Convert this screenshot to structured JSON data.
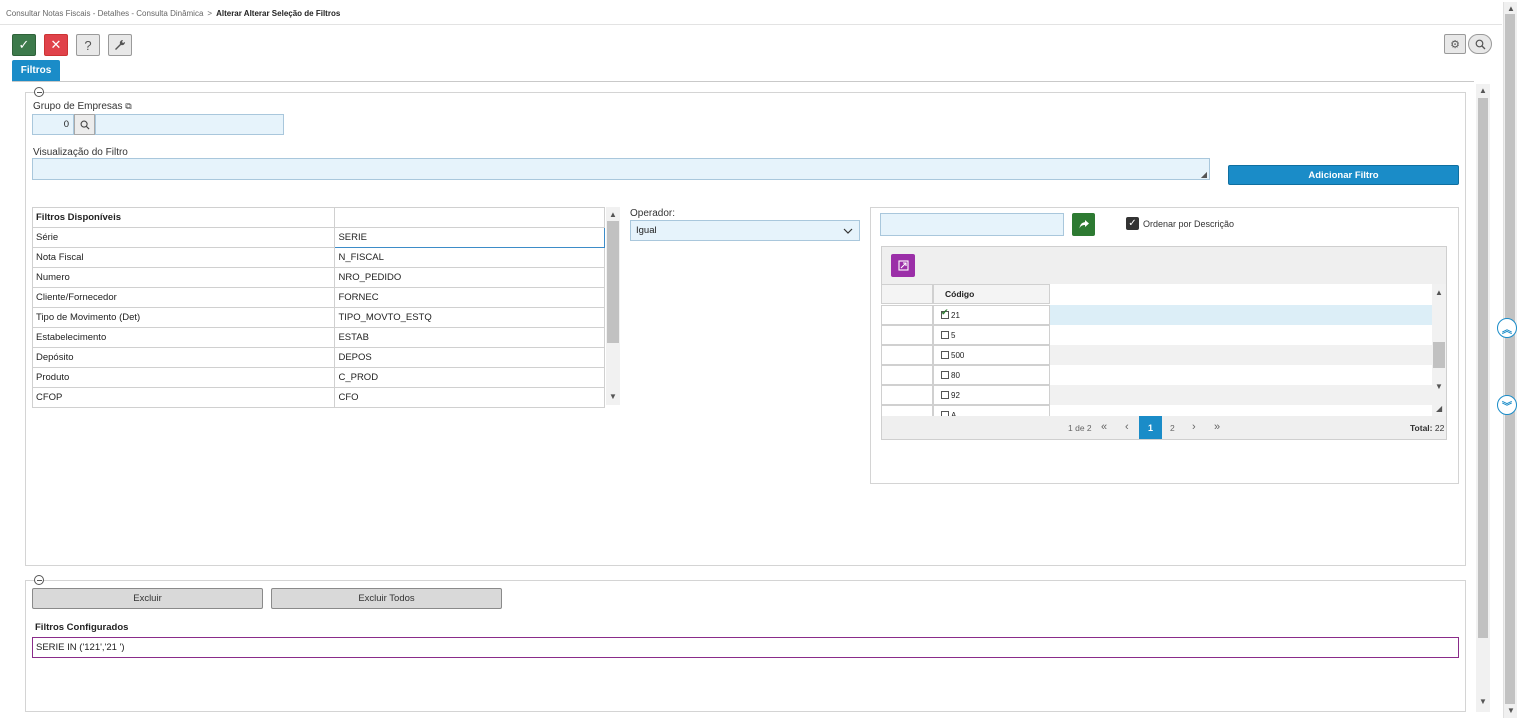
{
  "breadcrumb": {
    "parent": "Consultar Notas Fiscais - Detalhes - Consulta Dinâmica",
    "separator": ">",
    "current": "Alterar Alterar Seleção de Filtros"
  },
  "toolbar": {
    "confirm_icon": "check-icon",
    "cancel_icon": "close-icon",
    "help_label": "?",
    "tools_icon": "wrench-icon"
  },
  "tabs": [
    {
      "label": "Filtros"
    }
  ],
  "form": {
    "grupo_empresas_label": "Grupo de Empresas",
    "grupo_empresas_value": "0",
    "visualizacao_label": "Visualização do Filtro",
    "visualizacao_value": "",
    "add_filter_label": "Adicionar Filtro",
    "operador_label": "Operador:",
    "operador_value": "Igual",
    "search_value": "",
    "ordenar_label": "Ordenar por Descrição"
  },
  "filtros_disponiveis": {
    "header": "Filtros Disponíveis",
    "rows": [
      {
        "label": "Série",
        "field": "SERIE"
      },
      {
        "label": "Nota Fiscal",
        "field": "N_FISCAL"
      },
      {
        "label": "Numero",
        "field": "NRO_PEDIDO"
      },
      {
        "label": "Cliente/Fornecedor",
        "field": "FORNEC"
      },
      {
        "label": "Tipo de Movimento (Det)",
        "field": "TIPO_MOVTO_ESTQ"
      },
      {
        "label": "Estabelecimento",
        "field": "ESTAB"
      },
      {
        "label": "Depósito",
        "field": "DEPOS"
      },
      {
        "label": "Produto",
        "field": "C_PROD"
      },
      {
        "label": "CFOP",
        "field": "CFO"
      }
    ]
  },
  "codigo_grid": {
    "header": "Código",
    "rows": [
      {
        "value": "21",
        "checked": true
      },
      {
        "value": "5",
        "checked": false
      },
      {
        "value": "500",
        "checked": false
      },
      {
        "value": "80",
        "checked": false
      },
      {
        "value": "92",
        "checked": false
      },
      {
        "value": "A",
        "checked": false
      }
    ],
    "pagination": {
      "info": "1 de 2",
      "first": "«",
      "prev": "‹",
      "page1": "1",
      "page2": "2",
      "next": "›",
      "last": "»",
      "total_label": "Total:",
      "total_value": "22"
    }
  },
  "bottom": {
    "excluir_label": "Excluir",
    "excluir_todos_label": "Excluir Todos",
    "configurados_header": "Filtros Configurados",
    "configurados_rows": [
      "SERIE IN ('121','21 ')"
    ]
  },
  "colors": {
    "accent": "#1a8cc8",
    "confirm": "#3d7a4b",
    "cancel": "#e0424a",
    "selection_border": "#8a2c8a",
    "export_button": "#9b2fa8"
  }
}
